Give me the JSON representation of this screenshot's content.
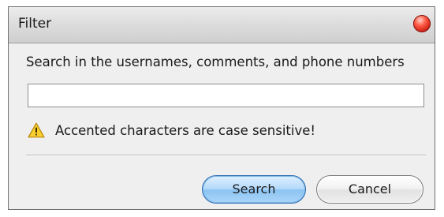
{
  "window": {
    "title": "Filter"
  },
  "search": {
    "prompt": "Search in the usernames, comments, and phone numbers",
    "value": "",
    "placeholder": ""
  },
  "warning": {
    "icon": "warning-triangle-icon",
    "text": "Accented characters are case sensitive!"
  },
  "buttons": {
    "search_label": "Search",
    "cancel_label": "Cancel"
  },
  "colors": {
    "warning_fill": "#f7cf2e",
    "close_button": "#e0301e",
    "default_button": "#8cc4f3"
  }
}
